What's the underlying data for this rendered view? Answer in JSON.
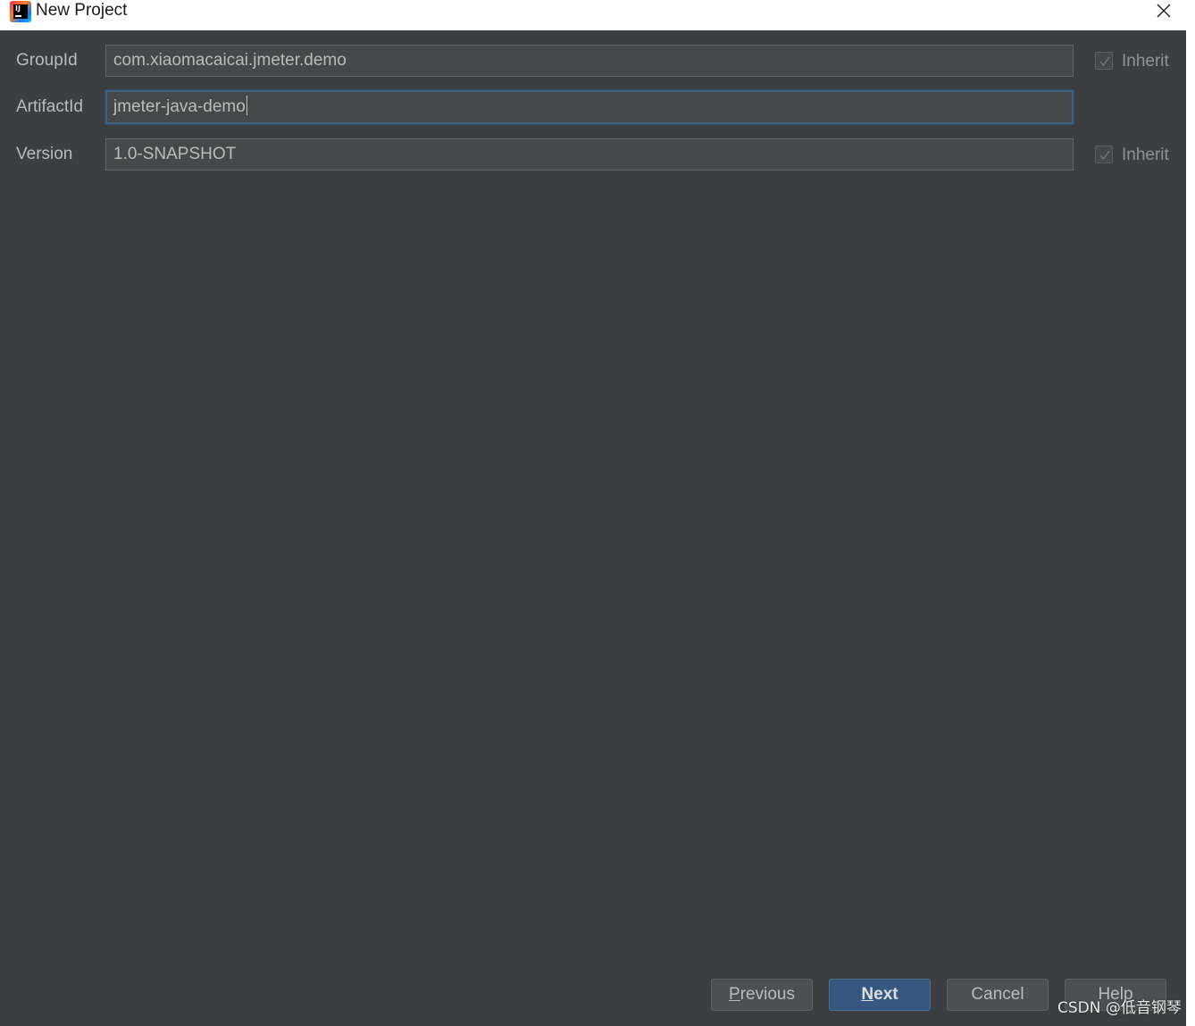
{
  "window": {
    "title": "New Project"
  },
  "form": {
    "group_id": {
      "label": "GroupId",
      "value": "com.xiaomacaicai.jmeter.demo",
      "inherit_label": "Inherit",
      "inherit_checked": true
    },
    "artifact_id": {
      "label": "ArtifactId",
      "value": "jmeter-java-demo"
    },
    "version": {
      "label": "Version",
      "value": "1.0-SNAPSHOT",
      "inherit_label": "Inherit",
      "inherit_checked": true
    }
  },
  "buttons": {
    "previous_mnemonic": "P",
    "previous_rest": "revious",
    "next_mnemonic": "N",
    "next_rest": "ext",
    "cancel": "Cancel",
    "help": "Help"
  },
  "watermark": "CSDN @低音钢琴",
  "icons": {
    "app": "intellij-idea-icon",
    "close": "close-icon",
    "check": "checkmark-icon"
  },
  "colors": {
    "dialog_bg": "#3c3f41",
    "field_bg": "#45494a",
    "focus_border": "#3d6185",
    "primary_button": "#365880"
  }
}
